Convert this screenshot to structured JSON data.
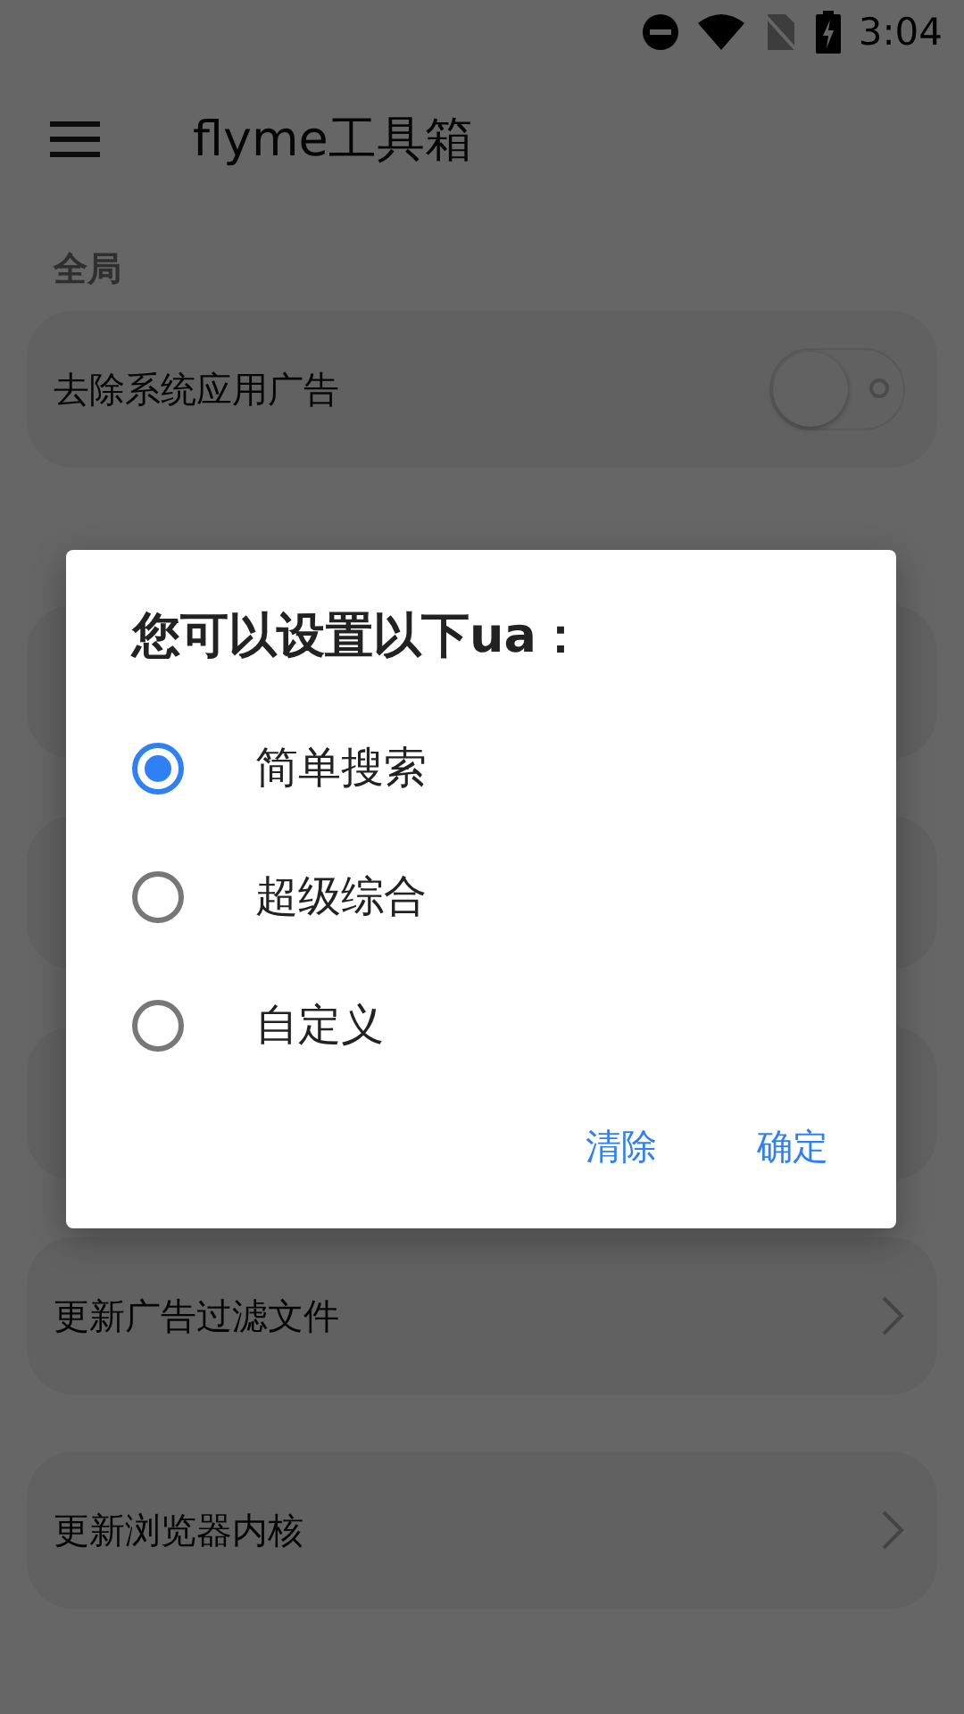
{
  "status_bar": {
    "time": "3:04"
  },
  "app_bar": {
    "title": "flyme工具箱"
  },
  "sections": [
    {
      "title": "全局",
      "items": [
        {
          "label": "去除系统应用广告",
          "kind": "switch",
          "on": false
        }
      ]
    }
  ],
  "more_items": [
    {
      "label": "更新广告过滤文件",
      "kind": "link"
    },
    {
      "label": "更新浏览器内核",
      "kind": "link"
    }
  ],
  "dialog": {
    "title": "您可以设置以下ua：",
    "options": [
      {
        "label": "简单搜索",
        "selected": true
      },
      {
        "label": "超级综合",
        "selected": false
      },
      {
        "label": "自定义",
        "selected": false
      }
    ],
    "buttons": [
      "清除",
      "确定"
    ]
  }
}
